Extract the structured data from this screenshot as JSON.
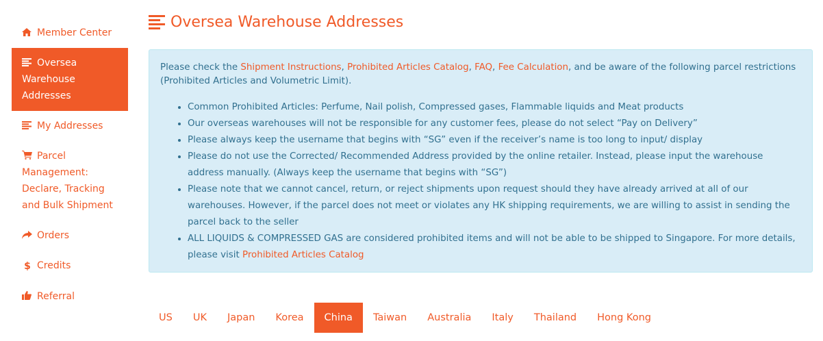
{
  "sidebar": {
    "items": [
      {
        "label": "Member Center",
        "icon": "home-icon"
      },
      {
        "label": "Oversea Warehouse Addresses",
        "icon": "list-icon",
        "active": true
      },
      {
        "label": "My Addresses",
        "icon": "list-icon"
      },
      {
        "label": "Parcel Management: Declare, Tracking and Bulk Shipment",
        "icon": "cart-icon"
      },
      {
        "label": "Orders",
        "icon": "share-icon"
      },
      {
        "label": "Credits",
        "icon": "dollar-icon"
      },
      {
        "label": "Referral",
        "icon": "thumbs-up-icon"
      }
    ]
  },
  "page": {
    "title": "Oversea Warehouse Addresses",
    "title_icon": "list-icon"
  },
  "notice": {
    "intro_prefix": "Please check the ",
    "link_shipment": "Shipment Instructions",
    "sep1": ", ",
    "link_prohibited": "Prohibited Articles Catalog",
    "sep2": ", ",
    "link_faq": "FAQ",
    "sep3": ", ",
    "link_fee": "Fee Calculation",
    "intro_suffix": ", and be aware of the following parcel restrictions (Prohibited Articles and Volumetric Limit).",
    "bullets": [
      "Common Prohibited Articles: Perfume, Nail polish, Compressed gases, Flammable liquids and Meat products",
      "Our overseas warehouses will not be responsible for any customer fees, please do not select “Pay on Delivery”",
      "Please always keep the username that begins with “SG” even if the receiver’s name is too long to input/ display",
      "Please do not use the Corrected/ Recommended Address provided by the online retailer. Instead, please input the warehouse address manually. (Always keep the username that begins with “SG”)",
      "Please note that we cannot cancel, return, or reject shipments upon request should they have already arrived at all of our warehouses. However, if the parcel does not meet or violates any HK shipping requirements, we are willing to assist in sending the parcel back to the seller"
    ],
    "last_bullet_text": "ALL LIQUIDS & COMPRESSED GAS are considered prohibited items and will not be able to be shipped to Singapore. For more details, please visit ",
    "last_bullet_link": "Prohibited Articles Catalog"
  },
  "tabs": [
    {
      "label": "US"
    },
    {
      "label": "UK"
    },
    {
      "label": "Japan"
    },
    {
      "label": "Korea"
    },
    {
      "label": "China",
      "active": true
    },
    {
      "label": "Taiwan"
    },
    {
      "label": "Australia"
    },
    {
      "label": "Italy"
    },
    {
      "label": "Thailand"
    },
    {
      "label": "Hong Kong"
    }
  ],
  "colors": {
    "accent": "#f05a28",
    "alert_bg": "#d9edf7",
    "alert_border": "#bce8f1",
    "alert_text": "#31708f"
  }
}
